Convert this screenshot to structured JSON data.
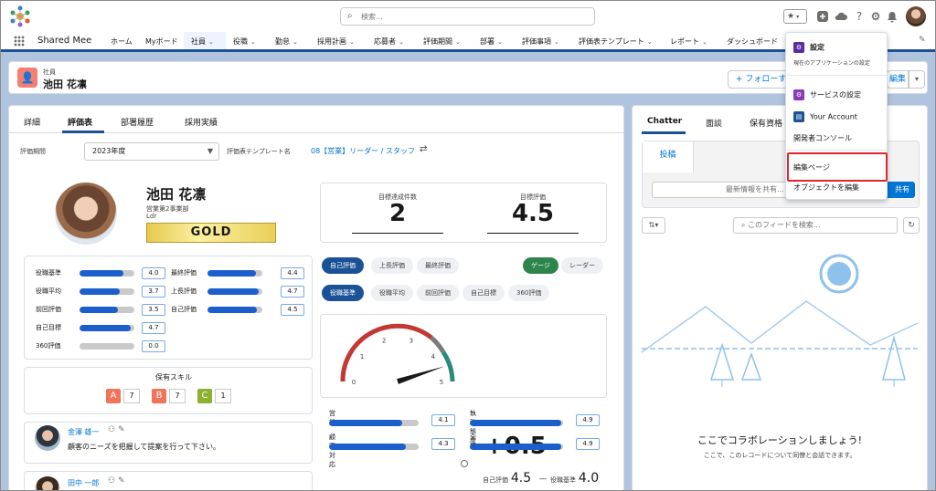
{
  "header": {
    "search_placeholder": "検索...",
    "icons": [
      "star-icon",
      "add-icon",
      "cloud-icon",
      "help-icon",
      "gear-icon",
      "bell-icon"
    ]
  },
  "nav": {
    "app_name": "Shared Mee",
    "items": [
      "ホーム",
      "Myボード",
      "社員",
      "役職",
      "勤怠",
      "採用計画",
      "応募者",
      "評価期間",
      "部署",
      "評価事項",
      "評価表テンプレート",
      "レポート",
      "ダッシュボード"
    ]
  },
  "record": {
    "type": "社員",
    "name": "池田 花凛",
    "follow_label": "+ フォローする",
    "edit_label": "編集"
  },
  "tabs": [
    "詳細",
    "評価表",
    "部署履歴",
    "採用実績"
  ],
  "filters": {
    "period_label": "評価期間",
    "period_value": "2023年度",
    "template_label": "評価表テンプレート名",
    "template_value": "08【営業】リーダー / スタッフ"
  },
  "profile": {
    "name": "池田 花凛",
    "dept": "営業第2事業部",
    "role": "Ldr",
    "rank": "GOLD"
  },
  "scores_left": [
    {
      "label": "役職基準",
      "value": "4.0",
      "fill": 0.8
    },
    {
      "label": "役職平均",
      "value": "3.7",
      "fill": 0.74
    },
    {
      "label": "前回評価",
      "value": "3.5",
      "fill": 0.7
    },
    {
      "label": "自己目標",
      "value": "4.7",
      "fill": 0.94
    },
    {
      "label": "360評価",
      "value": "0.0",
      "fill": 0
    }
  ],
  "scores_right": [
    {
      "label": "最終評価",
      "value": "4.4",
      "fill": 0.88
    },
    {
      "label": "上長評価",
      "value": "4.7",
      "fill": 0.94
    },
    {
      "label": "自己評価",
      "value": "4.5",
      "fill": 0.9
    }
  ],
  "skills": {
    "title": "保有スキル",
    "items": [
      {
        "grade": "A",
        "count": "7",
        "color": "#f0735a"
      },
      {
        "grade": "B",
        "count": "7",
        "color": "#f0735a"
      },
      {
        "grade": "C",
        "count": "1",
        "color": "#8bb12f"
      }
    ]
  },
  "feed": [
    {
      "name": "金澤 雄一",
      "text": "顧客のニーズを把握して提案を行って下さい。"
    },
    {
      "name": "田中 一郎",
      "text": ""
    }
  ],
  "kpi": {
    "goal_count_label": "目標達成件数",
    "goal_count_value": "2",
    "goal_eval_label": "目標評価",
    "goal_eval_value": "4.5"
  },
  "eval_toggle": [
    "自己評価",
    "上長評価",
    "最終評価"
  ],
  "view_toggle": [
    "ゲージ",
    "レーダー"
  ],
  "compare_toggle": [
    "役職基準",
    "役職平均",
    "前回評価",
    "自己目標",
    "360評価"
  ],
  "gauge": {
    "ticks": [
      "0",
      "1",
      "2",
      "3",
      "4",
      "5"
    ],
    "value": 4.5,
    "delta": "+0.5",
    "self_label": "自己評価",
    "self_value": "4.5",
    "base_label": "役職基準",
    "base_value": "4.0",
    "dash": "—"
  },
  "categories": [
    {
      "label": "営業",
      "value": "4.1",
      "fill": 0.82
    },
    {
      "label": "執務態度",
      "value": "4.9",
      "fill": 0.98
    },
    {
      "label": "顧客対応",
      "value": "4.3",
      "fill": 0.86
    },
    {
      "label": "全般",
      "value": "4.9",
      "fill": 0.98
    }
  ],
  "chatter": {
    "tabs": [
      "Chatter",
      "面談",
      "保有資格"
    ],
    "post_tab": "投稿",
    "post_placeholder": "最新情報を共有...",
    "share_label": "共有",
    "feed_search_placeholder": "このフィードを検索...",
    "empty_title": "ここでコラボレーションしましょう!",
    "empty_sub": "ここで、このレコードについて同僚と会話できます。"
  },
  "setup_menu": {
    "setup": "設定",
    "setup_sub": "現在のアプリケーションの設定",
    "service_setup": "サービスの設定",
    "your_account": "Your Account",
    "dev_console": "開発者コンソール",
    "edit_page": "編集ページ",
    "edit_object": "オブジェクトを編集"
  }
}
